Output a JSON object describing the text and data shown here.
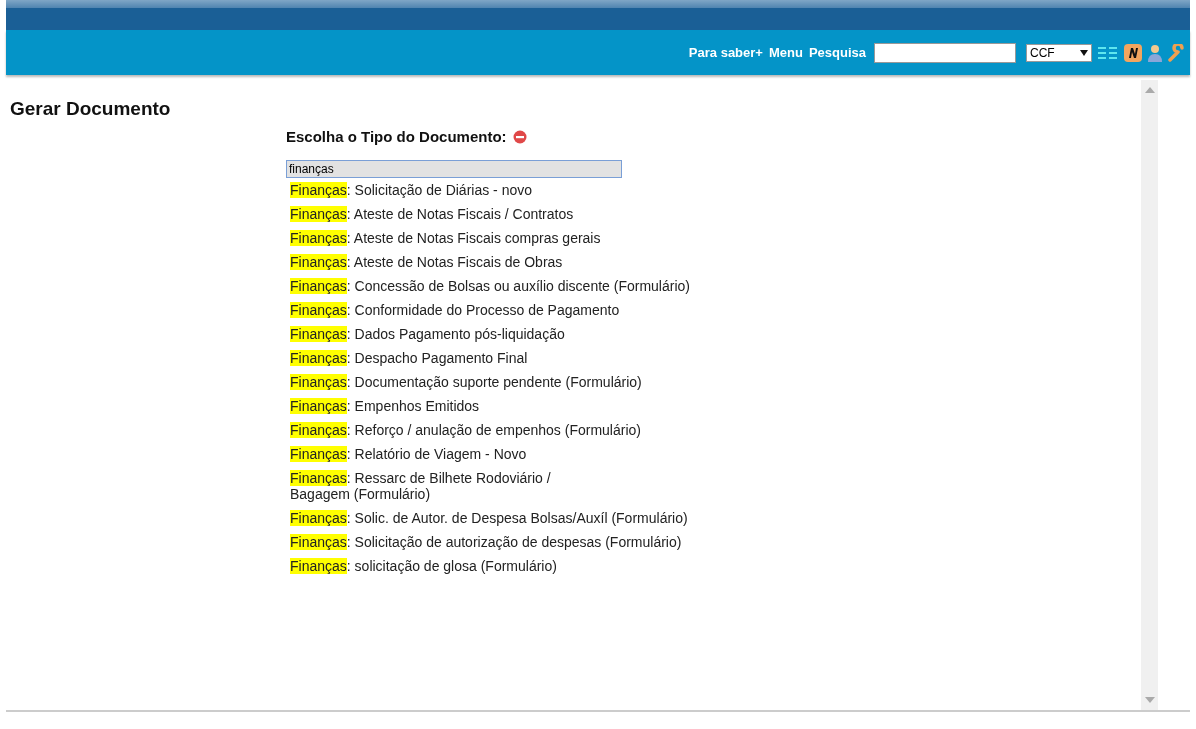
{
  "header": {
    "links": [
      "Para saber+",
      "Menu",
      "Pesquisa"
    ],
    "select": {
      "value": "CCF"
    }
  },
  "page_title": "Gerar Documento",
  "chooser": {
    "heading": "Escolha o Tipo do Documento:",
    "filter": {
      "value": "finanças"
    },
    "items": [
      {
        "match": "Finanças",
        "rest": ": Solicitação de Diárias - novo"
      },
      {
        "match": "Finanças",
        "rest": ": Ateste de Notas Fiscais / Contratos"
      },
      {
        "match": "Finanças",
        "rest": ": Ateste de Notas Fiscais compras gerais"
      },
      {
        "match": "Finanças",
        "rest": ": Ateste de Notas Fiscais de Obras"
      },
      {
        "match": "Finanças",
        "rest": ": Concessão de Bolsas ou auxílio discente (Formulário)"
      },
      {
        "match": "Finanças",
        "rest": ": Conformidade do Processo de Pagamento"
      },
      {
        "match": "Finanças",
        "rest": ": Dados Pagamento pós-liquidação"
      },
      {
        "match": "Finanças",
        "rest": ": Despacho Pagamento Final"
      },
      {
        "match": "Finanças",
        "rest": ": Documentação suporte pendente (Formulário)"
      },
      {
        "match": "Finanças",
        "rest": ": Empenhos Emitidos"
      },
      {
        "match": "Finanças",
        "rest": ": Reforço / anulação de empenhos (Formulário)"
      },
      {
        "match": "Finanças",
        "rest": ": Relatório de Viagem - Novo"
      },
      {
        "match": "Finanças",
        "rest": ": Ressarc de Bilhete Rodoviário /\nBagagem (Formulário)"
      },
      {
        "match": "Finanças",
        "rest": ": Solic. de Autor. de Despesa Bolsas/Auxíl (Formulário)"
      },
      {
        "match": "Finanças",
        "rest": ": Solicitação de autorização de despesas (Formulário)"
      },
      {
        "match": "Finanças",
        "rest": ": solicitação de glosa (Formulário)"
      }
    ]
  }
}
